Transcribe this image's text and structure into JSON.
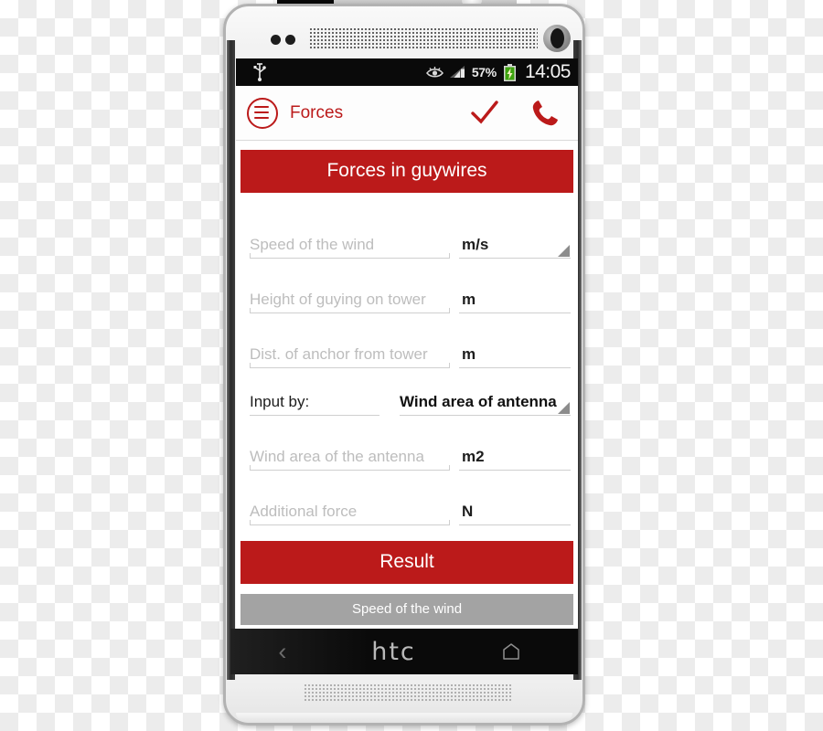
{
  "device": {
    "brand": "htc",
    "nav": {
      "back": "‹",
      "home": "home-icon"
    },
    "icons": {
      "front_camera": "front-camera-icon",
      "earpiece_grille": "speaker-grille-icon",
      "bottom_grille": "speaker-grille-icon",
      "sensor_dots": "proximity-sensor-icon"
    }
  },
  "statusbar": {
    "usb_icon": "usb-icon",
    "eye_icon": "eye-icon",
    "signal_icon": "signal-bars-icon",
    "battery_percent": "57%",
    "battery_icon": "battery-charging-icon",
    "clock": "14:05"
  },
  "actionbar": {
    "menu_icon": "hamburger-menu-icon",
    "title": "Forces",
    "confirm_icon": "check-icon",
    "call_icon": "phone-call-icon"
  },
  "content": {
    "banner_title": "Forces in guywires",
    "fields": [
      {
        "placeholder": "Speed of the wind",
        "unit": "m/s",
        "has_caret": true
      },
      {
        "placeholder": "Height of guying on tower",
        "unit": "m",
        "has_caret": false
      },
      {
        "placeholder": "Dist. of anchor from tower",
        "unit": "m",
        "has_caret": false
      }
    ],
    "input_by": {
      "label": "Input by:",
      "value": "Wind area of antenna",
      "caret": "dropdown-caret-icon"
    },
    "fields2": [
      {
        "placeholder": "Wind area of the antenna",
        "unit": "m2",
        "has_caret": false
      },
      {
        "placeholder": "Additional force",
        "unit": "N",
        "has_caret": false
      }
    ],
    "result_button": "Result",
    "result_header": "Speed of the wind"
  },
  "colors": {
    "brand_red": "#bb1a1a",
    "grey_bar": "#a3a3a3",
    "placeholder": "#bdbdbd",
    "underline": "#cfcfcf",
    "statusbar_bg": "#0a0a0a"
  }
}
